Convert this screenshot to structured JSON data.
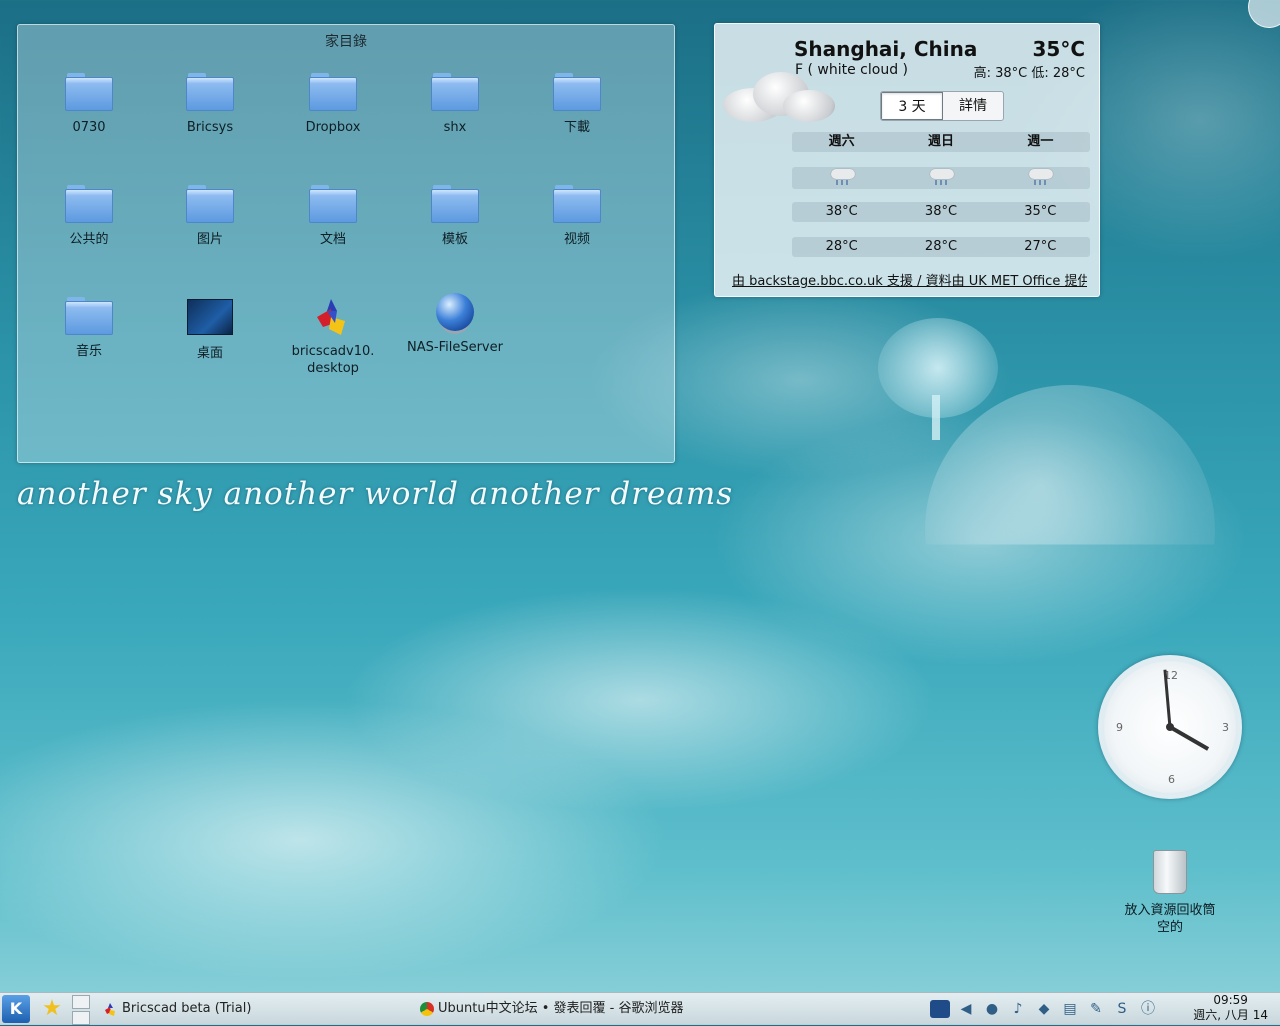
{
  "desktop": {
    "slogan": "another sky another world another dreams"
  },
  "folderview": {
    "title": "家目錄",
    "items": [
      {
        "label": "0730",
        "icon": "folder-icon"
      },
      {
        "label": "Bricsys",
        "icon": "folder-icon"
      },
      {
        "label": "Dropbox",
        "icon": "folder-icon"
      },
      {
        "label": "shx",
        "icon": "folder-icon"
      },
      {
        "label": "下載",
        "icon": "folder-icon"
      },
      {
        "label": "公共的",
        "icon": "folder-icon"
      },
      {
        "label": "图片",
        "icon": "folder-icon"
      },
      {
        "label": "文档",
        "icon": "folder-icon"
      },
      {
        "label": "模板",
        "icon": "folder-icon"
      },
      {
        "label": "视频",
        "icon": "folder-icon"
      },
      {
        "label": "音乐",
        "icon": "folder-icon"
      },
      {
        "label": "桌面",
        "icon": "desktop-icon"
      },
      {
        "label": "bricscadv10.",
        "label2": "desktop",
        "icon": "bricscad-icon"
      },
      {
        "label": "NAS-FileServer",
        "icon": "globe-icon"
      }
    ]
  },
  "weather": {
    "city": "Shanghai, China",
    "temp": "35°C",
    "condition": "F   ( white cloud )",
    "hilo": "高: 38°C  低: 28°C",
    "tabs": [
      "3 天",
      "詳情"
    ],
    "days": [
      "週六",
      "週日",
      "週一"
    ],
    "highs": [
      "38°C",
      "38°C",
      "35°C"
    ],
    "lows": [
      "28°C",
      "28°C",
      "27°C"
    ],
    "credit": "由 backstage.bbc.co.uk 支援 / 資料由 UK MET Office 提供"
  },
  "clock": {
    "numbers": {
      "n12": "12",
      "n3": "3",
      "n6": "6",
      "n9": "9"
    },
    "hour_angle_deg": -60,
    "minute_angle_deg": -95
  },
  "trash": {
    "line1": "放入資源回收筒",
    "line2": "空的"
  },
  "taskbar": {
    "tasks": [
      "Bricscad beta (Trial)",
      "Ubuntu中文论坛 • 發表回覆 - 谷歌浏览器"
    ],
    "time": "09:59",
    "date": "週六, 八月 14"
  }
}
